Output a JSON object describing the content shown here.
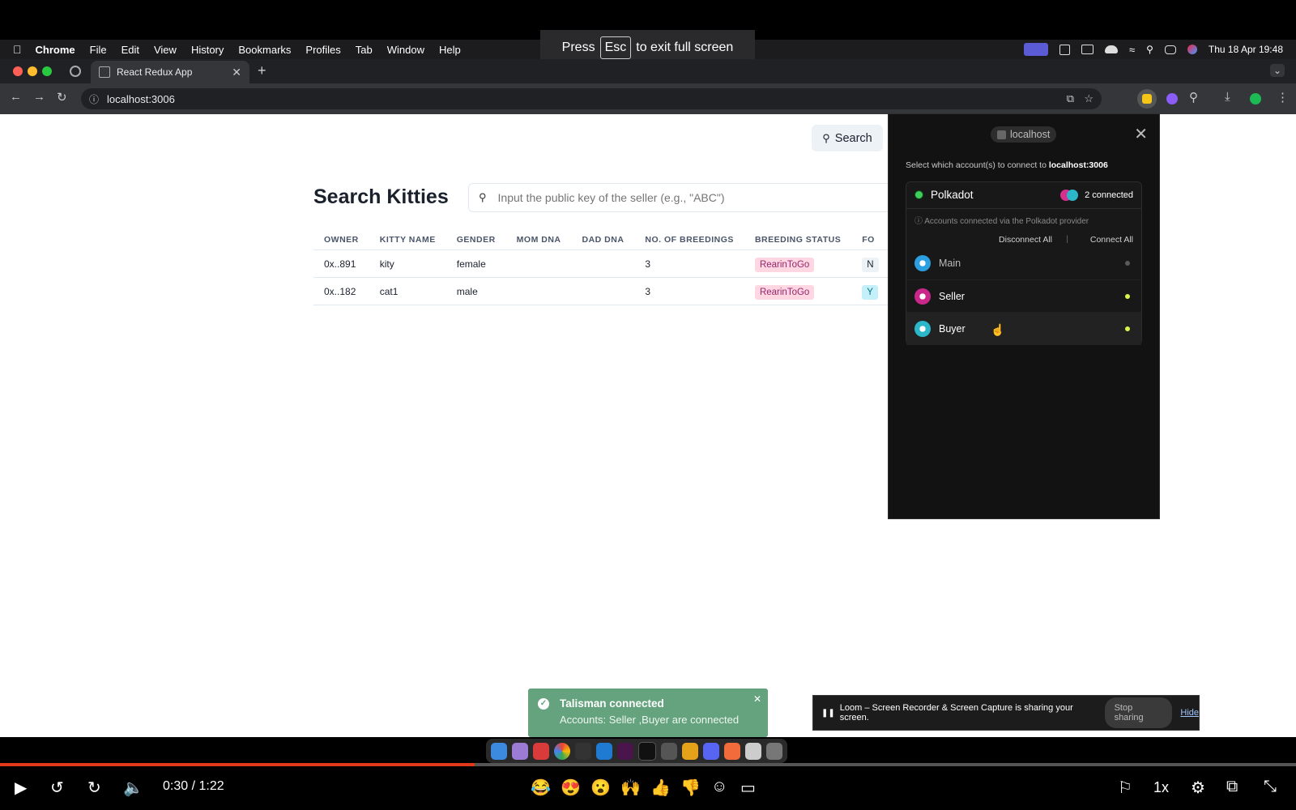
{
  "menubar": {
    "app": "Chrome",
    "items": [
      "File",
      "Edit",
      "View",
      "History",
      "Bookmarks",
      "Profiles",
      "Tab",
      "Window",
      "Help"
    ],
    "clock": "Thu 18 Apr  19:48"
  },
  "fullscreen_toast": {
    "pre": "Press",
    "key": "Esc",
    "post": "to exit full screen"
  },
  "browser": {
    "tab_title": "React Redux App",
    "url": "localhost:3006"
  },
  "page": {
    "search_button": "Search",
    "title": "Search Kitties",
    "search_placeholder": "Input the public key of the seller (e.g., \"ABC\")",
    "columns": [
      "OWNER",
      "KITTY NAME",
      "GENDER",
      "MOM DNA",
      "DAD DNA",
      "NO. OF BREEDINGS",
      "BREEDING STATUS",
      "FO"
    ],
    "rows": [
      {
        "owner": "0x..891",
        "name": "kity",
        "gender": "female",
        "mom": "",
        "dad": "",
        "breedings": "3",
        "status": "RearinToGo",
        "fo": "N"
      },
      {
        "owner": "0x..182",
        "name": "cat1",
        "gender": "male",
        "mom": "",
        "dad": "",
        "breedings": "3",
        "status": "RearinToGo",
        "fo": "Y"
      }
    ]
  },
  "talisman": {
    "site": "localhost",
    "select_prefix": "Select which account(s) to connect to",
    "select_site": "localhost:3006",
    "provider": "Polkadot",
    "connected_count": "2 connected",
    "provider_note": "Accounts connected via the Polkadot provider",
    "disconnect_all": "Disconnect All",
    "connect_all": "Connect All",
    "accounts": [
      {
        "name": "Main",
        "connected": false
      },
      {
        "name": "Seller",
        "connected": true
      },
      {
        "name": "Buyer",
        "connected": true
      }
    ]
  },
  "toast": {
    "title": "Talisman connected",
    "message": "Accounts: Seller ,Buyer are connected"
  },
  "loom": {
    "message": "Loom – Screen Recorder & Screen Capture is sharing your screen.",
    "stop": "Stop sharing",
    "hide": "Hide"
  },
  "video": {
    "time": "0:30 / 1:22",
    "progress": 0.366,
    "speed": "1x",
    "reactions": [
      "😂",
      "😍",
      "😮",
      "🙌",
      "👍",
      "👎"
    ]
  },
  "colors": {
    "accent": "#e2381b",
    "toast_green": "#64a37d",
    "dot_on": "#d8f54a",
    "dot_off": "#5a5a5a"
  }
}
